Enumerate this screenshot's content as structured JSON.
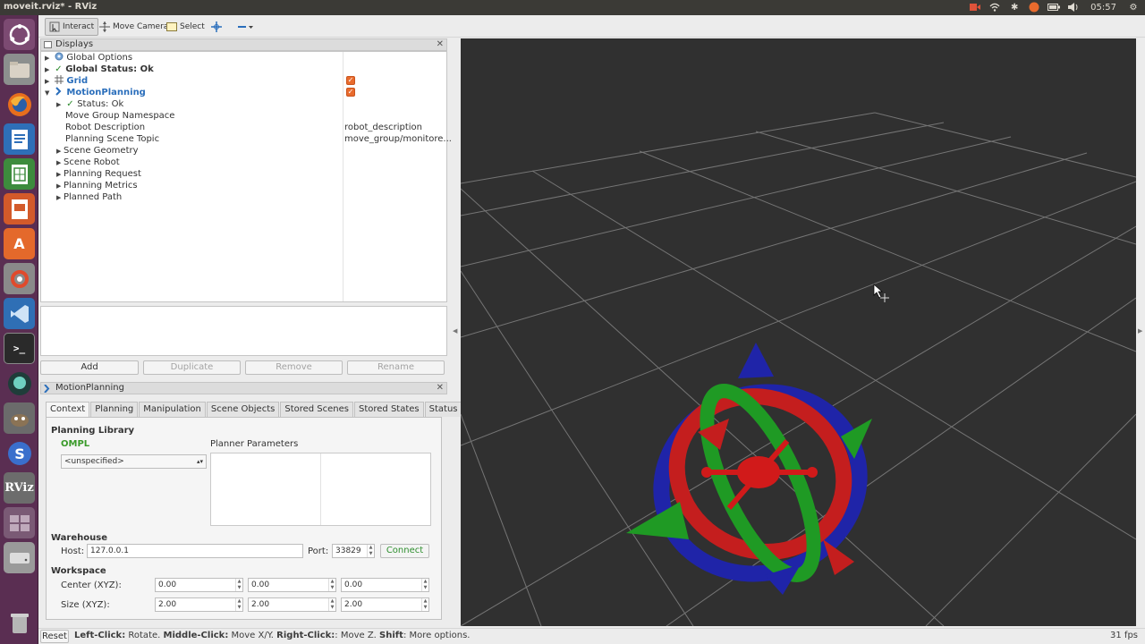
{
  "window": {
    "title": "moveit.rviz* - RViz"
  },
  "tray": {
    "clock": "05:57"
  },
  "launcher": {
    "rviz_label": "RViz"
  },
  "toolbar": {
    "interact": "Interact",
    "move_camera": "Move Camera",
    "select": "Select"
  },
  "displays": {
    "title": "Displays",
    "items": [
      {
        "label": "Global Options"
      },
      {
        "label": "Global Status: Ok"
      },
      {
        "label": "Grid"
      },
      {
        "label": "MotionPlanning"
      },
      {
        "label": "Status: Ok"
      },
      {
        "label": "Move Group Namespace",
        "value": ""
      },
      {
        "label": "Robot Description",
        "value": "robot_description"
      },
      {
        "label": "Planning Scene Topic",
        "value": "move_group/monitore..."
      },
      {
        "label": "Scene Geometry"
      },
      {
        "label": "Scene Robot"
      },
      {
        "label": "Planning Request"
      },
      {
        "label": "Planning Metrics"
      },
      {
        "label": "Planned Path"
      }
    ],
    "buttons": {
      "add": "Add",
      "duplicate": "Duplicate",
      "remove": "Remove",
      "rename": "Rename"
    }
  },
  "motion_planning": {
    "title": "MotionPlanning",
    "tabs": [
      "Context",
      "Planning",
      "Manipulation",
      "Scene Objects",
      "Stored Scenes",
      "Stored States",
      "Status"
    ],
    "planning_library": {
      "heading": "Planning Library",
      "library": "OMPL",
      "planner_select": "<unspecified>",
      "planner_params_label": "Planner Parameters"
    },
    "warehouse": {
      "heading": "Warehouse",
      "host_label": "Host:",
      "host": "127.0.0.1",
      "port_label": "Port:",
      "port": "33829",
      "connect": "Connect"
    },
    "workspace": {
      "heading": "Workspace",
      "center_label": "Center (XYZ):",
      "center": [
        "0.00",
        "0.00",
        "0.00"
      ],
      "size_label": "Size (XYZ):",
      "size": [
        "2.00",
        "2.00",
        "2.00"
      ]
    }
  },
  "statusbar": {
    "reset": "Reset",
    "left_click_key": "Left-Click:",
    "left_click_val": " Rotate. ",
    "middle_click_key": "Middle-Click:",
    "middle_click_val": " Move X/Y. ",
    "right_click_key": "Right-Click:",
    "right_click_val": ": Move Z. ",
    "shift_key": "Shift",
    "shift_val": ": More options.",
    "fps": "31 fps"
  },
  "colors": {
    "launcher_bg": "#5a2e52",
    "view_bg": "#303030",
    "accent_orange": "#e96b2d",
    "link_blue": "#2a6ebb",
    "ok_green": "#2b8a2b"
  }
}
